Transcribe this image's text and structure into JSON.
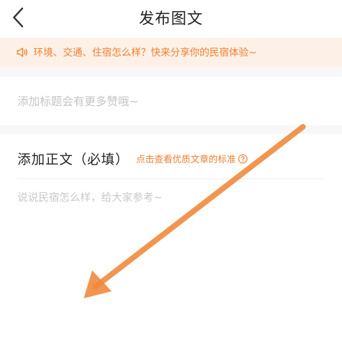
{
  "header": {
    "title": "发布图文",
    "back_icon": "chevron-left-icon"
  },
  "notice": {
    "icon": "speaker-icon",
    "text": "环境、交通、住宿怎么样？快来分享你的民宿体验~"
  },
  "title_field": {
    "placeholder": "添加标题会有更多赞哦~",
    "value": ""
  },
  "body_field": {
    "heading": "添加正文（必填）",
    "standards_link": "点击查看优质文章的标准",
    "help_icon": "question-circle-icon",
    "placeholder": "说说民宿怎么样，给大家参考~",
    "value": ""
  },
  "annotation": {
    "icon": "arrow-icon",
    "color": "#f08a3c"
  },
  "colors": {
    "accent": "#f07f2e",
    "notice_bg": "#fdf1e7",
    "section_gap": "#f7f7f9"
  }
}
